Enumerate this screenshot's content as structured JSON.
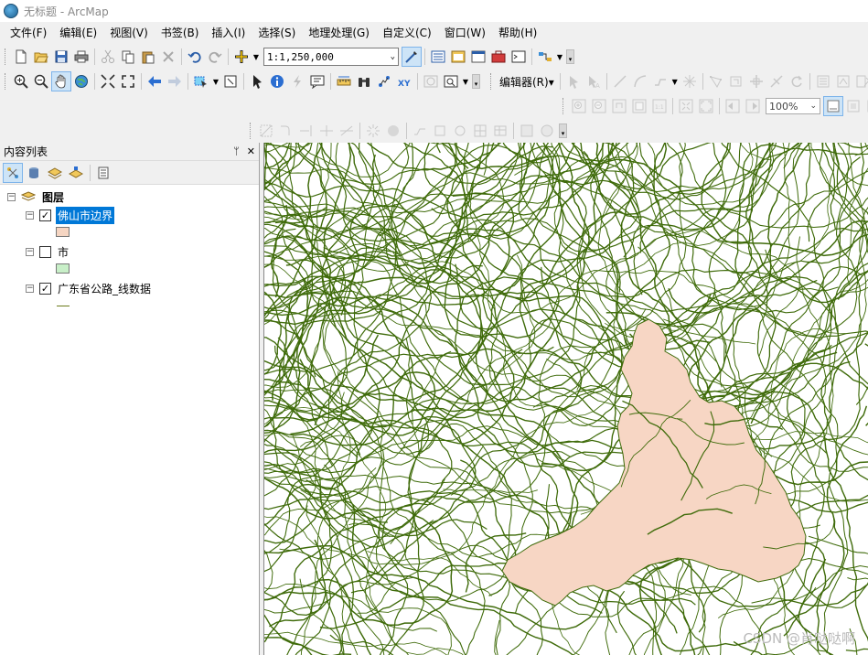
{
  "window": {
    "title": "无标题 - ArcMap"
  },
  "menu": [
    "文件(F)",
    "编辑(E)",
    "视图(V)",
    "书签(B)",
    "插入(I)",
    "选择(S)",
    "地理处理(G)",
    "自定义(C)",
    "窗口(W)",
    "帮助(H)"
  ],
  "toolbar": {
    "scale_value": "1:1,250,000",
    "editor_label": "编辑器(R)▾",
    "zoom_value": "100%"
  },
  "toc": {
    "title": "内容列表",
    "pin": "ᛘ",
    "close": "✕",
    "root_label": "图层",
    "layers": [
      {
        "name": "佛山市边界",
        "checked": true,
        "selected": true,
        "symbol": "polygon",
        "fill": "#f5d5c2"
      },
      {
        "name": "市",
        "checked": false,
        "selected": false,
        "symbol": "polygon",
        "fill": "#c8efc8"
      },
      {
        "name": "广东省公路_线数据",
        "checked": true,
        "selected": false,
        "symbol": "line",
        "fill": "#6b7b1a"
      }
    ]
  },
  "map": {
    "road_color": "#3f6b0a",
    "polygon_fill": "#f7d6c4",
    "watermark": "CSDN @肖哒哒啊"
  },
  "icons": [
    "new-icon",
    "open-icon",
    "save-icon",
    "print-icon",
    "cut-icon",
    "copy-icon",
    "paste-icon",
    "delete-icon",
    "undo-icon",
    "redo-icon",
    "add-data-icon",
    "zoom-in-icon",
    "zoom-out-icon",
    "pan-icon",
    "globe-icon",
    "identify-icon",
    "find-icon",
    "layers-icon",
    "editor-icon"
  ]
}
